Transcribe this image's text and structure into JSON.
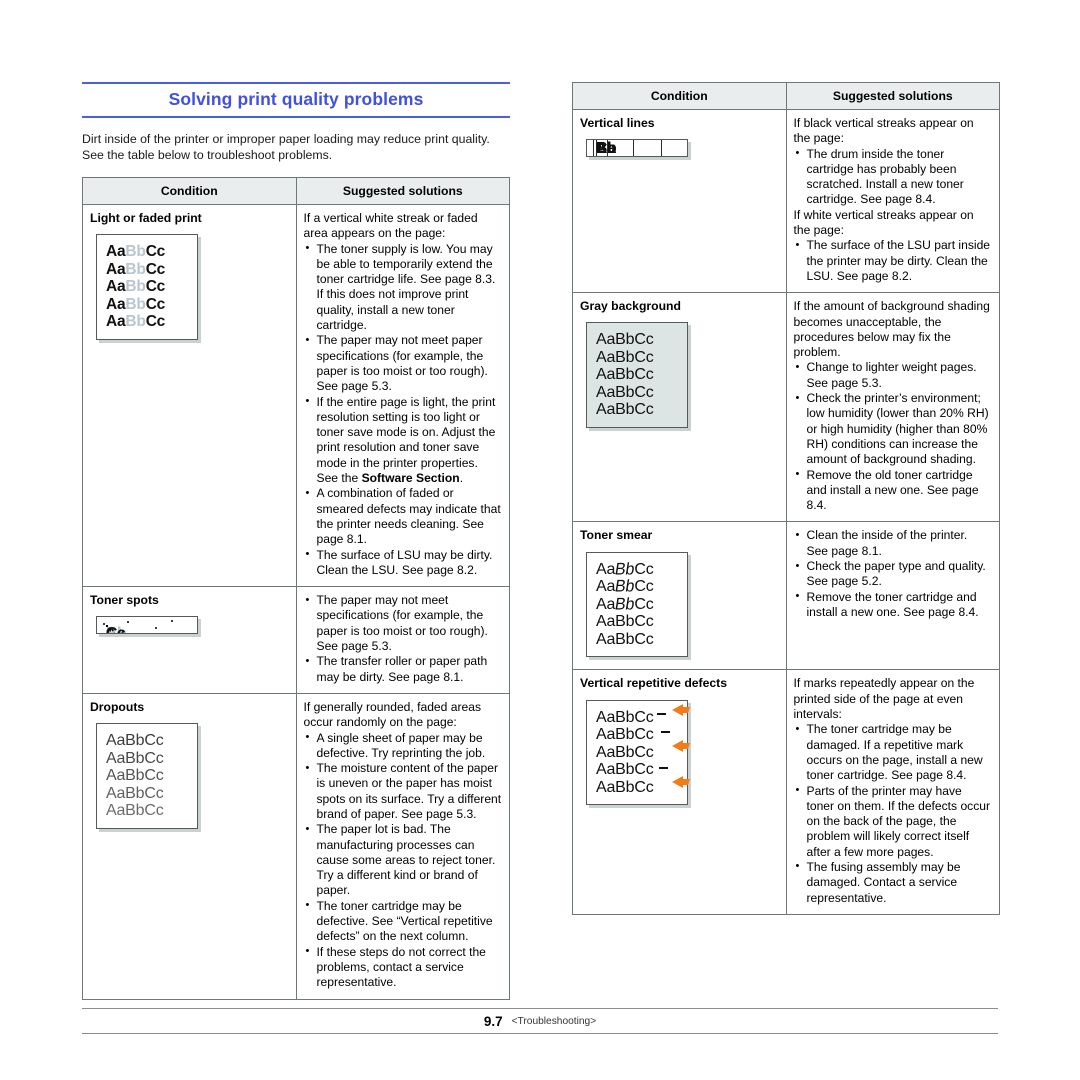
{
  "section": {
    "title": "Solving print quality problems",
    "intro": "Dirt inside of the printer or improper paper loading may reduce print quality. See the table below to troubleshoot problems.",
    "title_color": "#4050e0",
    "rule_color": "#4a5ee8"
  },
  "table_headers": {
    "condition": "Condition",
    "solutions": "Suggested solutions"
  },
  "left_table": {
    "rows": [
      {
        "condition": "Light or faded print",
        "sample": "light-faded",
        "intro": "If a vertical white streak or faded area appears on the page:",
        "bullets": [
          "The toner supply is low. You may be able to temporarily extend the toner cartridge life. See page 8.3. If this does not improve print quality, install a new toner cartridge.",
          "The paper may not meet paper specifications (for example, the paper is too moist or too rough). See page 5.3.",
          "If the entire page is light, the print resolution setting is too light or toner save mode is on. Adjust the print resolution and toner save mode in the printer properties. See the ",
          "A combination of faded or smeared defects may indicate that the printer needs cleaning. See page 8.1.",
          "The surface of LSU may be dirty. Clean the LSU. See page 8.2."
        ],
        "bullet3_bold": "Software Section",
        "bullet3_tail": "."
      },
      {
        "condition": "Toner spots",
        "sample": "toner-spots",
        "intro": "",
        "bullets": [
          "The paper may not meet specifications (for example, the paper is too moist or too rough). See page 5.3.",
          "The transfer roller or paper path may be dirty. See page 8.1."
        ]
      },
      {
        "condition": "Dropouts",
        "sample": "dropouts",
        "intro": "If generally rounded, faded areas occur randomly on the page:",
        "bullets": [
          "A single sheet of paper may be defective. Try reprinting the job.",
          "The moisture content of the paper is uneven or the paper has moist spots on its surface. Try a different brand of paper. See page 5.3.",
          "The paper lot is bad. The manufacturing processes can cause some areas to reject toner. Try a different kind or brand of paper.",
          "The toner cartridge may be defective. See “Vertical repetitive defects” on the next column.",
          "If these steps do not correct the problems, contact a service representative."
        ]
      }
    ]
  },
  "right_table": {
    "rows": [
      {
        "condition": "Vertical lines",
        "sample": "vertical-lines",
        "intro": "If black vertical streaks appear on the page:",
        "bullets": [
          "The drum inside the toner cartridge has probably been scratched. Install a new toner cartridge. See page 8.4."
        ],
        "intro2": "If white vertical streaks appear on the page:",
        "bullets2": [
          "The surface of the LSU part inside the printer may be dirty. Clean the LSU. See page 8.2."
        ]
      },
      {
        "condition": "Gray background",
        "sample": "gray-background",
        "intro": "If the amount of background shading becomes unacceptable, the procedures below may fix the problem.",
        "bullets": [
          "Change to lighter weight pages. See page 5.3.",
          "Check the printer’s environment; low humidity (lower than 20% RH) or high humidity (higher than 80% RH) conditions can increase the amount of background shading.",
          "Remove the old toner cartridge and install a new one. See page 8.4."
        ]
      },
      {
        "condition": "Toner smear",
        "sample": "toner-smear",
        "intro": "",
        "bullets": [
          "Clean the inside of the printer. See page 8.1.",
          "Check the paper type and quality. See page 5.2.",
          "Remove the toner cartridge and install a new one. See page 8.4."
        ]
      },
      {
        "condition": "Vertical repetitive defects",
        "sample": "repetitive-defects",
        "intro": "If marks repeatedly appear on the printed side of the page at even intervals:",
        "bullets": [
          "The toner cartridge may be damaged. If a repetitive mark occurs on the page, install a new toner cartridge. See page 8.4.",
          "Parts of the printer may have toner on them. If the defects occur on the back of the page, the problem will likely correct itself after a few more pages.",
          "The fusing assembly may be damaged. Contact a service representative."
        ]
      }
    ]
  },
  "sample_text": {
    "prefix": "Aa",
    "middle": "Bb",
    "suffix": "Cc",
    "line_count": 5
  },
  "footer": {
    "page": "9.7",
    "section": "<Troubleshooting>"
  }
}
